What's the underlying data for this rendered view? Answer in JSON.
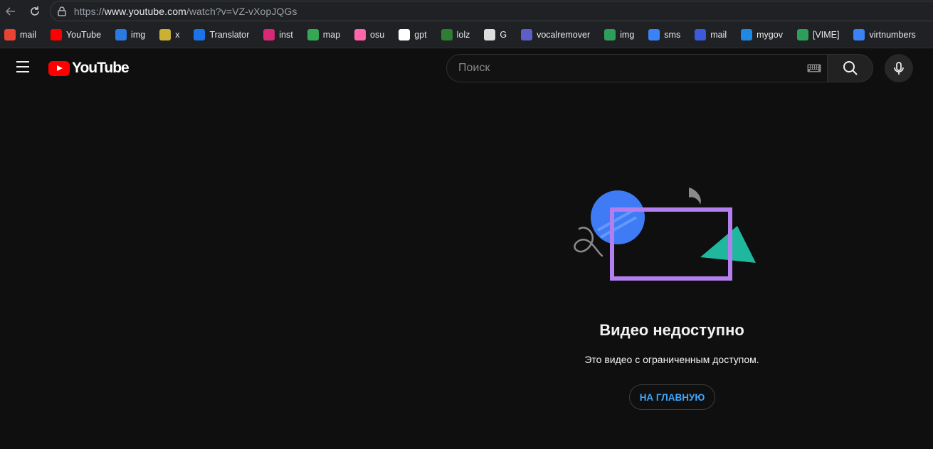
{
  "browser": {
    "url_scheme": "https://",
    "url_host": "www.youtube.com",
    "url_path": "/watch?v=VZ-vXopJQGs"
  },
  "bookmarks": [
    {
      "label": "mail",
      "icon": "gmail-icon",
      "color": "#ea4335"
    },
    {
      "label": "YouTube",
      "icon": "youtube-icon",
      "color": "#ff0000"
    },
    {
      "label": "img",
      "icon": "imgbb-icon",
      "color": "#2a7ae2"
    },
    {
      "label": "x",
      "icon": "x-icon",
      "color": "#c9b037"
    },
    {
      "label": "Translator",
      "icon": "translator-icon",
      "color": "#1a73e8"
    },
    {
      "label": "inst",
      "icon": "instagram-icon",
      "color": "#d62976"
    },
    {
      "label": "map",
      "icon": "maps-icon",
      "color": "#34a853"
    },
    {
      "label": "osu",
      "icon": "osu-icon",
      "color": "#ff66aa"
    },
    {
      "label": "gpt",
      "icon": "chatgpt-icon",
      "color": "#ffffff"
    },
    {
      "label": "lolz",
      "icon": "lolz-icon",
      "color": "#2e7d32"
    },
    {
      "label": "G",
      "icon": "database-icon",
      "color": "#dddddd"
    },
    {
      "label": "vocalremover",
      "icon": "vocalremover-icon",
      "color": "#5b5fc7"
    },
    {
      "label": "img",
      "icon": "image-icon",
      "color": "#2e9e5b"
    },
    {
      "label": "sms",
      "icon": "sms-icon",
      "color": "#3b82f6"
    },
    {
      "label": "mail",
      "icon": "mailru-icon",
      "color": "#3b5bdb"
    },
    {
      "label": "mygov",
      "icon": "mygov-icon",
      "color": "#1e88e5"
    },
    {
      "label": "[VIME]",
      "icon": "vime-icon",
      "color": "#2e9e5b"
    },
    {
      "label": "virtnumbers",
      "icon": "virtnumbers-icon",
      "color": "#3b82f6"
    }
  ],
  "header": {
    "logo_text": "YouTube",
    "search_placeholder": "Поиск"
  },
  "message": {
    "title": "Видео недоступно",
    "subtitle": "Это видео с ограниченным доступом.",
    "home_button": "НА ГЛАВНУЮ"
  },
  "colors": {
    "background": "#0f0f0f",
    "accent_blue": "#3ea6ff",
    "logo_red": "#ff0000",
    "illustration_circle": "#3f7bf4",
    "illustration_frame": "#b27ef0",
    "illustration_triangle": "#1fb89e"
  }
}
